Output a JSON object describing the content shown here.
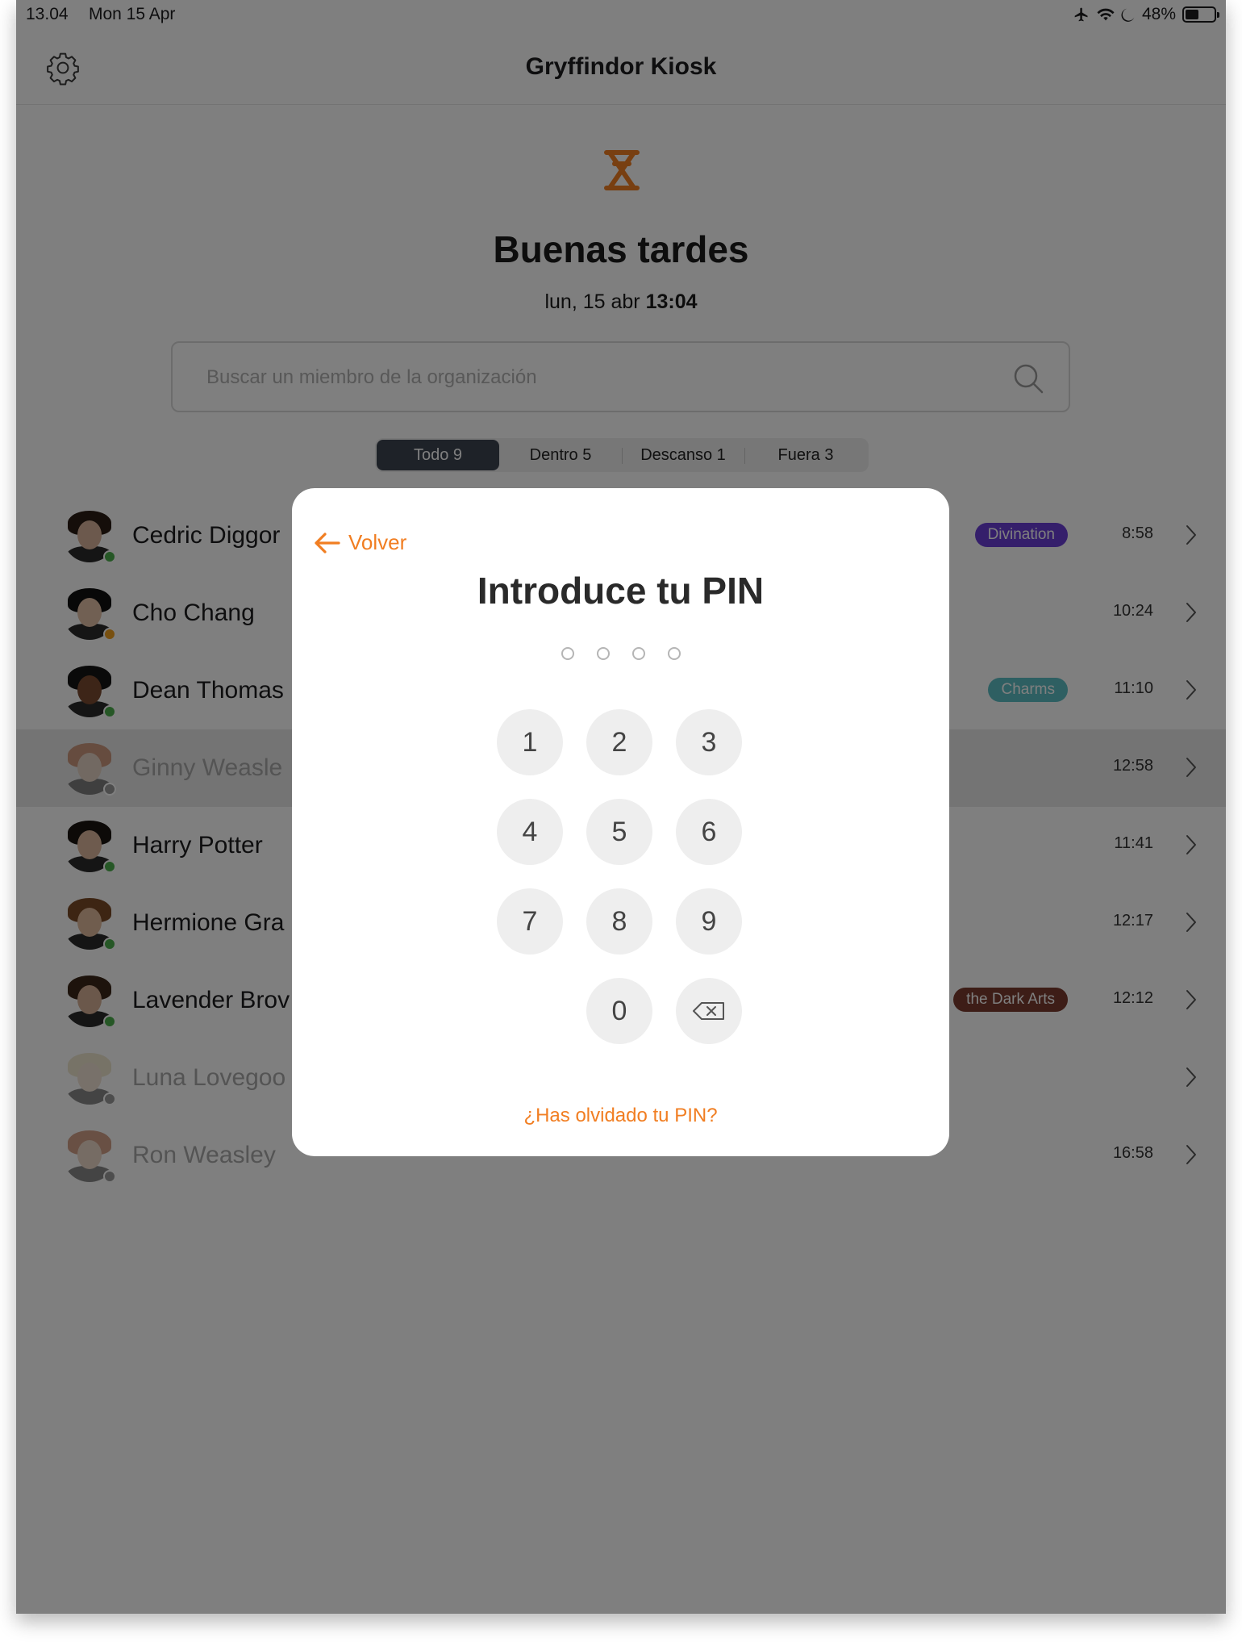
{
  "status_bar": {
    "time": "13.04",
    "date": "Mon 15 Apr",
    "battery": "48%",
    "battery_level": 0.48
  },
  "header": {
    "title": "Gryffindor Kiosk",
    "settings_icon": "gear-icon"
  },
  "colors": {
    "accent": "#f17e22",
    "active_filter": "#3c4451",
    "online": "#4cae4c",
    "break": "#f0a020",
    "offline": "#9a9a9a"
  },
  "greeting": "Buenas tardes",
  "date_line": {
    "date": "lun, 15 abr",
    "time": "13:04"
  },
  "search": {
    "placeholder": "Buscar un miembro de la organización",
    "icon": "search-icon"
  },
  "filters": [
    {
      "label": "Todo 9",
      "active": true
    },
    {
      "label": "Dentro 5",
      "active": false
    },
    {
      "label": "Descanso 1",
      "active": false
    },
    {
      "label": "Fuera 3",
      "active": false
    }
  ],
  "members": [
    {
      "name": "Cedric Diggory",
      "visible_name": "Cedric Diggor",
      "status": "online",
      "tag": "Divination",
      "tag_color": "#6a3fd6",
      "time": "8:58"
    },
    {
      "name": "Cho Chang",
      "visible_name": "Cho Chang",
      "status": "break",
      "tag": "",
      "tag_color": "",
      "time": "10:24"
    },
    {
      "name": "Dean Thomas",
      "visible_name": "Dean Thomas",
      "status": "online",
      "tag": "Charms",
      "tag_color": "#5dbfc4",
      "time": "11:10"
    },
    {
      "name": "Ginny Weasley",
      "visible_name": "Ginny Weasle",
      "status": "offline",
      "tag": "",
      "tag_color": "",
      "time": "12:58"
    },
    {
      "name": "Harry Potter",
      "visible_name": "Harry Potter",
      "status": "online",
      "tag": "",
      "tag_color": "",
      "time": "11:41"
    },
    {
      "name": "Hermione Granger",
      "visible_name": "Hermione Gra",
      "status": "online",
      "tag": "",
      "tag_color": "",
      "time": "12:17"
    },
    {
      "name": "Lavender Brown",
      "visible_name": "Lavender Brov",
      "status": "online",
      "tag": "the Dark Arts",
      "tag_color": "#7a3a2e",
      "time": "12:12"
    },
    {
      "name": "Luna Lovegood",
      "visible_name": "Luna Lovegoo",
      "status": "offline",
      "tag": "",
      "tag_color": "",
      "time": ""
    },
    {
      "name": "Ron Weasley",
      "visible_name": "Ron Weasley",
      "status": "offline",
      "tag": "",
      "tag_color": "",
      "time": "16:58"
    }
  ],
  "pin_modal": {
    "back_label": "Volver",
    "title": "Introduce tu PIN",
    "pin_length": 4,
    "keys": [
      "1",
      "2",
      "3",
      "4",
      "5",
      "6",
      "7",
      "8",
      "9",
      "0"
    ],
    "backspace_icon": "backspace-icon",
    "forgot_label": "¿Has olvidado tu PIN?"
  }
}
